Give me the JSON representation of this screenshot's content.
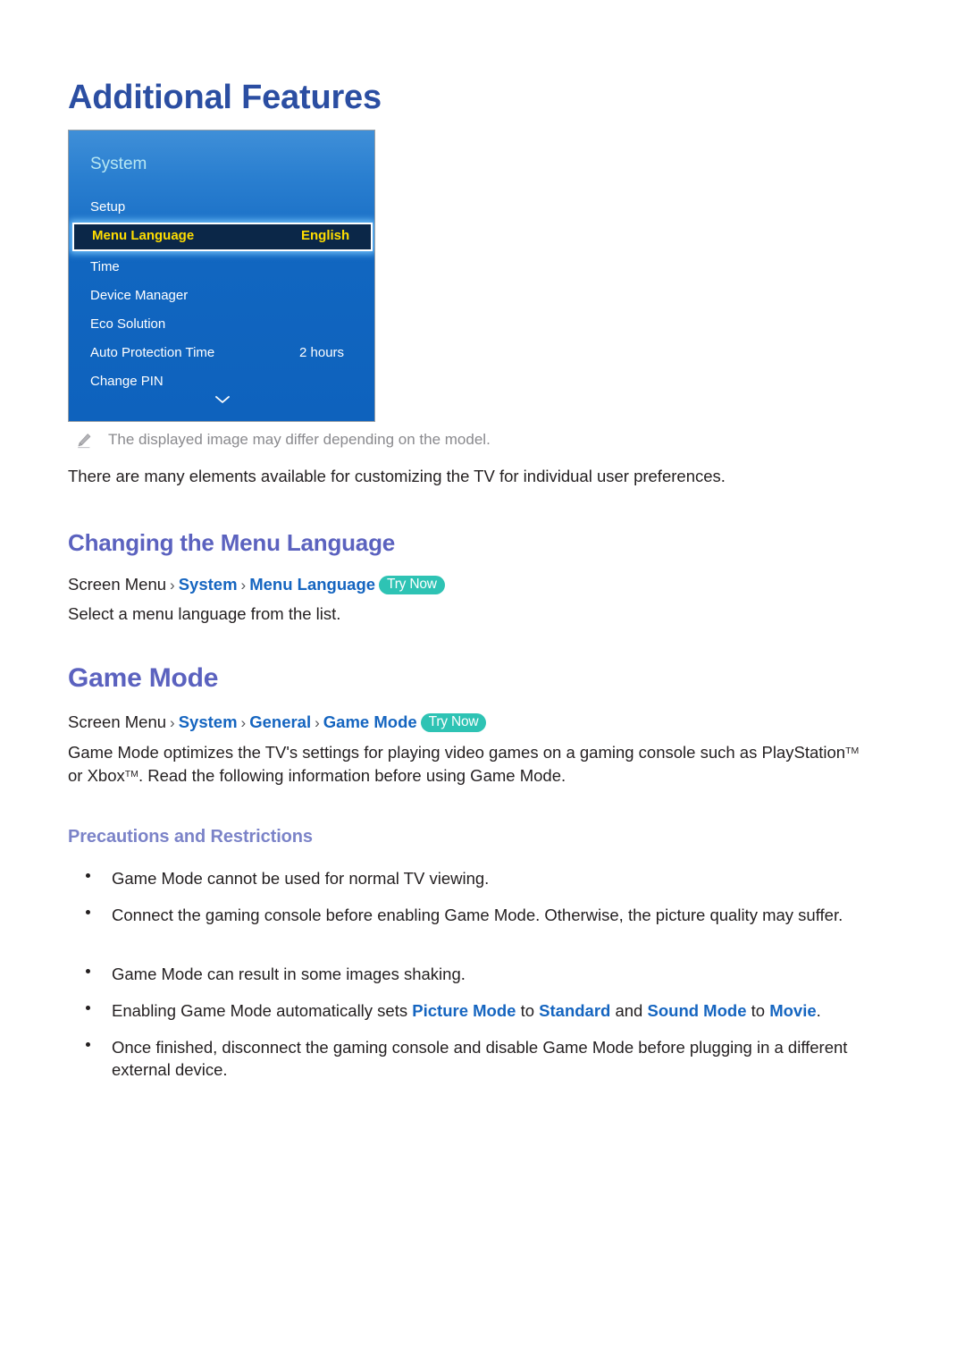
{
  "document": {
    "title": "Additional Features"
  },
  "tv_menu": {
    "header": "System",
    "scroll_icon": "chevron-down-icon",
    "rows": [
      {
        "label": "Setup",
        "value": "",
        "selected": false
      },
      {
        "label": "Menu Language",
        "value": "English",
        "selected": true
      },
      {
        "label": "Time",
        "value": "",
        "selected": false
      },
      {
        "label": "Device Manager",
        "value": "",
        "selected": false
      },
      {
        "label": "Eco Solution",
        "value": "",
        "selected": false
      },
      {
        "label": "Auto Protection Time",
        "value": "2 hours",
        "selected": false
      },
      {
        "label": "Change PIN",
        "value": "",
        "selected": false
      }
    ]
  },
  "note": {
    "icon": "pencil-icon",
    "text": "The displayed image may differ depending on the model."
  },
  "intro": {
    "paragraph": "There are many elements available for customizing the TV for individual user preferences."
  },
  "section_menu_language": {
    "heading": "Changing the Menu Language",
    "breadcrumb": {
      "root": "Screen Menu",
      "separator": "›",
      "items": [
        "System",
        "Menu Language"
      ],
      "badge": "Try Now"
    },
    "body": "Select a menu language from the list."
  },
  "section_game_mode": {
    "heading": "Game Mode",
    "breadcrumb": {
      "root": "Screen Menu",
      "separator": "›",
      "items": [
        "System",
        "General",
        "Game Mode"
      ],
      "badge": "Try Now"
    },
    "paragraph_part1": "Game Mode optimizes the TV's settings for playing video games on a gaming console such as PlayStation",
    "tm1": "TM",
    "paragraph_part2": " or Xbox",
    "tm2": "TM",
    "paragraph_part3": ". Read the following information before using Game Mode.",
    "subheading": "Precautions and Restrictions",
    "bullets": [
      {
        "text": "Game Mode cannot be used for normal TV viewing."
      },
      {
        "text": "Connect the gaming console before enabling Game Mode. Otherwise, the picture quality may suffer."
      },
      {
        "text": "Game Mode can result in some images shaking."
      },
      {
        "rich": true,
        "p1": "Enabling Game Mode automatically sets ",
        "t1": "Picture Mode",
        "p2": " to ",
        "t2": "Standard",
        "p3": " and ",
        "t3": "Sound Mode",
        "p4": " to ",
        "t4": "Movie",
        "p5": "."
      },
      {
        "text": "Once finished, disconnect the gaming console and disable Game Mode before plugging in a different external device."
      }
    ]
  },
  "colors": {
    "title_blue": "#2b4ea2",
    "heading_purple": "#5b62bf",
    "subheading_purple": "#7b83c8",
    "link_blue": "#1565c0",
    "badge_teal": "#2ec3b4",
    "menu_highlight_bg": "#0b2748",
    "menu_highlight_text": "#ffdd00",
    "menu_header_text": "#b6e7f3",
    "note_gray": "#8a8a8e"
  }
}
